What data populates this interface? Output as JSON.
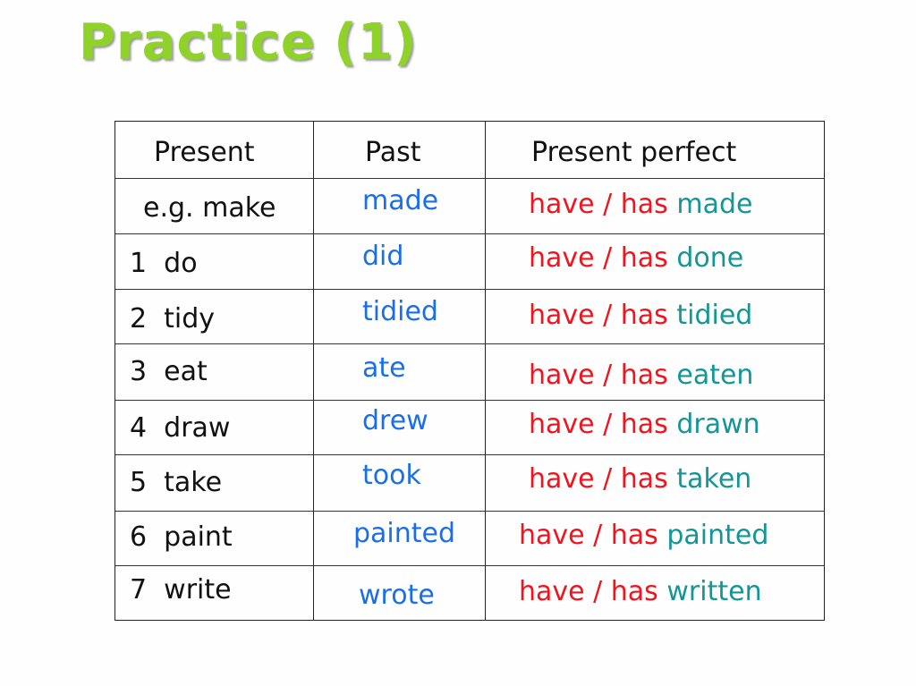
{
  "slide": {
    "title": "Practice (1)",
    "colors": {
      "title": "#8fd22a",
      "present": "#111111",
      "past": "#1a6fe8",
      "auxiliary": "#f0141e",
      "participle": "#149696"
    },
    "table": {
      "headers": [
        "Present",
        "Past",
        "Present perfect"
      ],
      "rows": [
        {
          "present": "e.g. make",
          "past": "made",
          "aux": "have / has",
          "participle": "made"
        },
        {
          "present": "1  do",
          "past": "did",
          "aux": "have / has",
          "participle": "done"
        },
        {
          "present": "2  tidy",
          "past": "tidied",
          "aux": "have / has",
          "participle": "tidied"
        },
        {
          "present": "3  eat",
          "past": "ate",
          "aux": "have / has",
          "participle": "eaten"
        },
        {
          "present": "4  draw",
          "past": "drew",
          "aux": "have / has",
          "participle": "drawn"
        },
        {
          "present": "5  take",
          "past": "took",
          "aux": "have / has",
          "participle": "taken"
        },
        {
          "present": "6  paint",
          "past": "painted",
          "aux": "have / has",
          "participle": "painted"
        },
        {
          "present": "7  write",
          "past": "wrote",
          "aux": "have / has",
          "participle": "written"
        }
      ]
    }
  }
}
